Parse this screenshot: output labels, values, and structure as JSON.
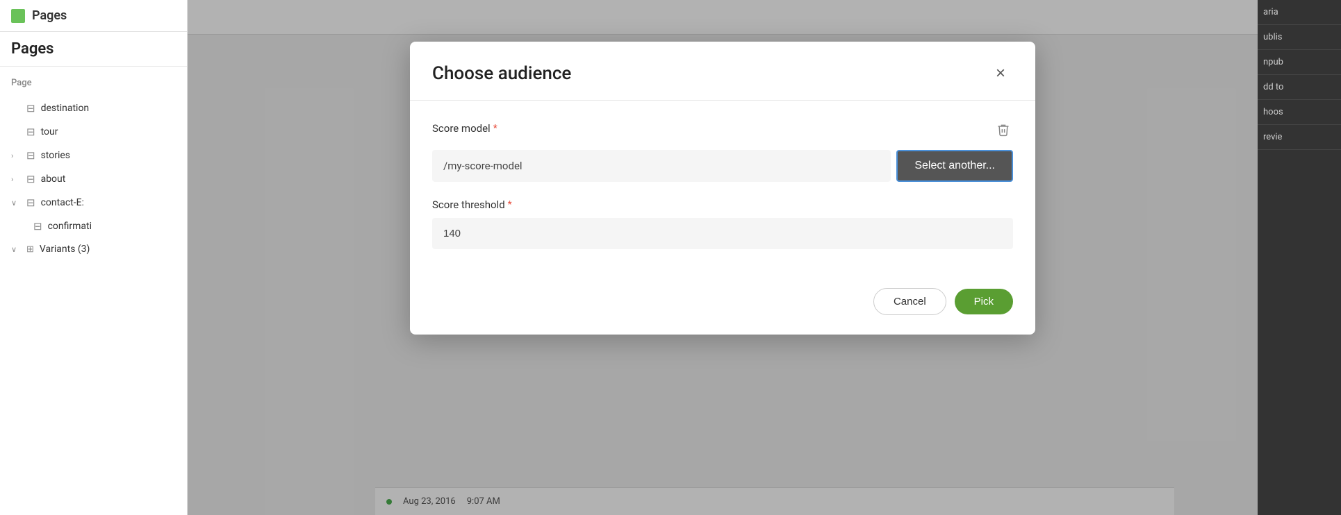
{
  "app": {
    "title": "Pages"
  },
  "sidebar": {
    "header_title": "Pages",
    "section_label": "Page",
    "items": [
      {
        "label": "destination",
        "indent": false,
        "expandable": false
      },
      {
        "label": "tour",
        "indent": false,
        "expandable": false
      },
      {
        "label": "stories",
        "indent": false,
        "expandable": true
      },
      {
        "label": "about",
        "indent": false,
        "expandable": true
      },
      {
        "label": "contact-E:",
        "indent": false,
        "expandable": true,
        "expanded": true
      },
      {
        "label": "confirmati",
        "indent": true,
        "expandable": false
      },
      {
        "label": "Variants (3)",
        "indent": false,
        "expandable": true,
        "expanded": true,
        "special": true
      }
    ]
  },
  "modal": {
    "title": "Choose audience",
    "close_label": "×",
    "score_model_label": "Score model",
    "score_model_value": "/my-score-model",
    "select_another_label": "Select another...",
    "score_threshold_label": "Score threshold",
    "score_threshold_value": "140",
    "cancel_label": "Cancel",
    "pick_label": "Pick"
  },
  "status_bar": {
    "date": "Aug 23, 2016",
    "time": "9:07 AM"
  },
  "right_panel": {
    "items": [
      "ublis",
      "npub",
      "dd to",
      "hoos",
      "revie"
    ]
  }
}
